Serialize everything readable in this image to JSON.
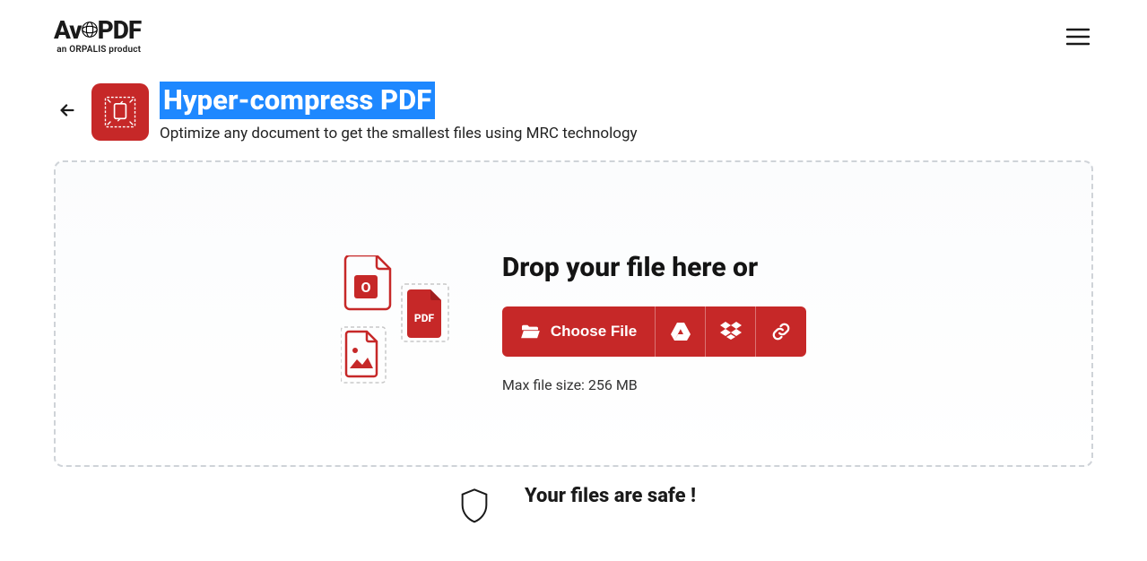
{
  "header": {
    "logo_text_pre": "Av",
    "logo_text_post": "PDF",
    "logo_subtitle": "an ORPALIS product"
  },
  "tool": {
    "title": "Hyper-compress PDF",
    "subtitle": "Optimize any document to get the smallest files using MRC technology"
  },
  "dropzone": {
    "heading": "Drop your file here or",
    "choose_label": "Choose File",
    "max_size": "Max file size: 256 MB"
  },
  "safe": {
    "title": "Your files are safe !"
  }
}
